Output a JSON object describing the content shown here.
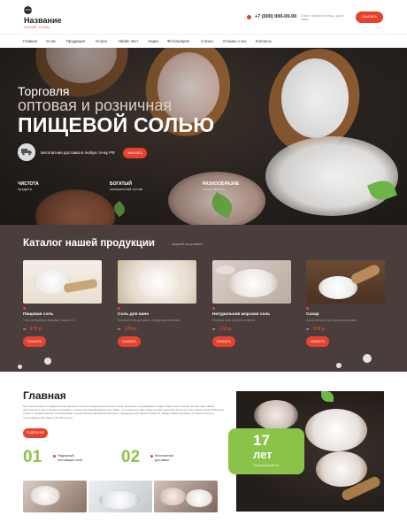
{
  "header": {
    "logo_mark": "LOGO",
    "title": "Название",
    "subtitle": "САХАР, СОЛЬ",
    "phone": "+7 (000) 000-00-00",
    "search_placeholder": "Поиск: название улицы, дом и офис",
    "button_label": "ЗАКАЗАТЬ"
  },
  "nav": {
    "items": [
      "Главная",
      "О нас",
      "Продукция",
      "Услуги",
      "Прайс-лист",
      "Акции",
      "Фотогалерея",
      "Статьи",
      "Отзывы о нас",
      "Контакты"
    ]
  },
  "hero": {
    "line1": "Торговля",
    "line2": "оптовая и розничная",
    "line3": "ПИЩЕВОЙ СОЛЬЮ",
    "delivery_text": "Бесплатная доставка в любую точку РФ",
    "button_label": "ЗАКАЗАТЬ",
    "features": [
      {
        "title": "ЧИСТОТА",
        "subtitle": "продукта"
      },
      {
        "title": "БОГАТЫЙ",
        "subtitle": "минеральный состав"
      },
      {
        "title": "РАЗНООБРАЗИЕ",
        "subtitle": "ассортимента"
      }
    ]
  },
  "catalog": {
    "title": "Каталог нашей продукции",
    "subtitle": "широкий ассортимент",
    "price_prefix": "от",
    "button_label": "ЗАКАЗАТЬ",
    "products": [
      {
        "name": "Пищевая соль",
        "desc": "Соль поваренная пищевая, помол № 1",
        "price": "170 р."
      },
      {
        "name": "Соль для ванн",
        "desc": "Морская соль для ванн с эфирными маслами",
        "price": "170 р."
      },
      {
        "name": "Натуральная морская соль",
        "desc": "Морская соль крупного помола",
        "price": "170 р."
      },
      {
        "name": "Сахар",
        "desc": "Сахар-песок белый кристаллический",
        "price": "170 р."
      }
    ]
  },
  "about": {
    "title": "Главная",
    "text": "Мы приглашаем к сотрудничеству крупные и мелкие продовольственные базы, магазины, супермаркеты, кафе, бары и рестораны. За все годы своей деятельности мы усовершенствовали технологию производства и доставки, что позволяет нам гарантировать высокое качество и выгодные цены. Работаем только с проверенными поставщиками и предлагаем широкий ассортимент продукции для наших клиентов. Предоставим удобные условия оплаты и оперативную доставку в любой регион.",
    "button_label": "ПОДРОБНЕЕ",
    "stats": [
      {
        "num": "01",
        "text": "Надежный поставщик соли"
      },
      {
        "num": "02",
        "text": "Бесплатная доставка"
      }
    ],
    "badge": {
      "num": "17",
      "label": "лет",
      "sub": "Успешной работы"
    }
  },
  "colors": {
    "accent": "#e8412c",
    "green": "#8bc34a",
    "dark": "#4a3e3c"
  }
}
